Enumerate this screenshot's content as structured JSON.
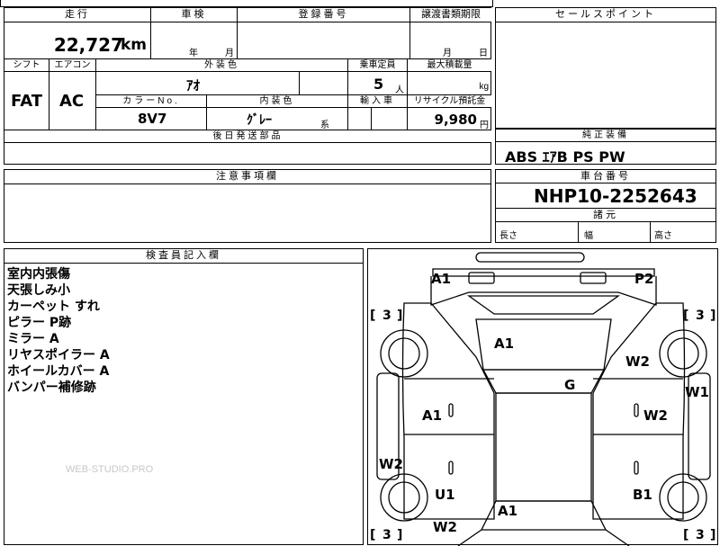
{
  "header": {
    "mileage_label": "走行",
    "mileage_value": "22,727",
    "mileage_unit": "km",
    "shaken_label": "車検",
    "shaken_year": "年",
    "shaken_month": "月",
    "reg_label": "登録番号",
    "transfer_label": "譲渡書類期限",
    "transfer_month": "月",
    "transfer_day": "日"
  },
  "specs": {
    "shift_label": "シフト",
    "shift_value": "FAT",
    "ac_label": "エアコン",
    "ac_value": "AC",
    "exterior_label": "外装色",
    "exterior_value": "ｱｵ",
    "capacity_label": "乗車定員",
    "capacity_value": "5",
    "capacity_unit": "人",
    "load_label": "最大積載量",
    "load_unit": "kg",
    "color_no_label": "カラーNo.",
    "color_no_value": "8V7",
    "interior_label": "内装色",
    "interior_value": "ｸﾞﾚｰ",
    "interior_suffix": "系",
    "import_label": "輸入車",
    "recycle_label": "リサイクル預託金",
    "recycle_value": "9,980",
    "recycle_unit": "円",
    "parts_label": "後日発送部品"
  },
  "sales": {
    "label": "セールスポイント"
  },
  "equipment": {
    "label": "純正装備",
    "value": "ABS ｴｱB PS PW"
  },
  "notes": {
    "label": "注意事項欄"
  },
  "chassis": {
    "label": "車台番号",
    "value": "NHP10-2252643",
    "dims_label": "諸元",
    "length_label": "長さ",
    "width_label": "幅",
    "height_label": "高さ"
  },
  "inspector": {
    "label": "検査員記入欄",
    "lines": [
      "室内内張傷",
      "天張しみ小",
      "カーペット すれ",
      "ピラー P跡",
      "ミラー A",
      "リヤスポイラー A",
      "ホイールカバー A",
      "バンパー補修跡"
    ],
    "watermark": "WEB-STUDIO.PRO"
  },
  "diagram": {
    "marks": {
      "front_left": "A1",
      "front_right": "P2",
      "hood": "A1",
      "roof": "G",
      "front_fender_r": "W2",
      "door_r_side": "W1",
      "front_door_l": "A1",
      "front_door_r": "W2",
      "rear_door_l": "W2",
      "rear_fender_l": "U1",
      "rear_fender_r": "B1",
      "trunk": "A1",
      "rear_bottom_l": "W2"
    },
    "tires": {
      "fl": "3",
      "fr": "3",
      "rl": "3",
      "rr": "3"
    }
  }
}
